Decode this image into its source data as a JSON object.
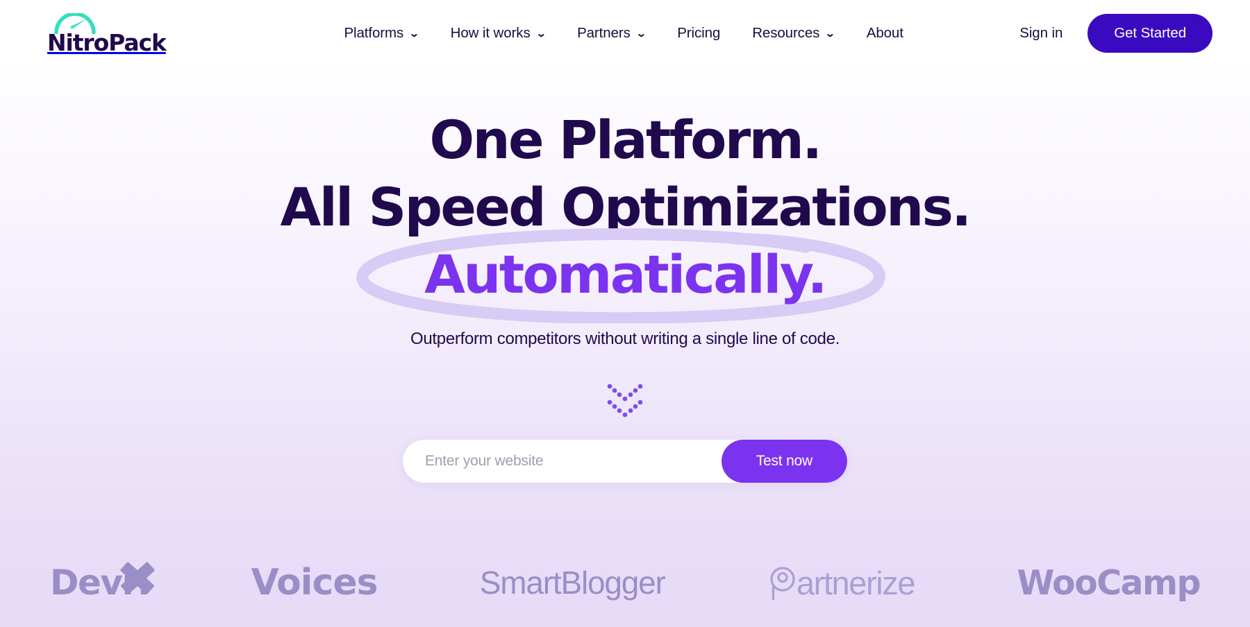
{
  "brand": {
    "name": "NitroPack",
    "logo_icon": "speedometer-icon",
    "accent_teal": "#2fe0bd",
    "wordmark_color": "#21094e"
  },
  "header": {
    "nav": [
      {
        "label": "Platforms",
        "has_dropdown": true
      },
      {
        "label": "How it works",
        "has_dropdown": true
      },
      {
        "label": "Partners",
        "has_dropdown": true
      },
      {
        "label": "Pricing",
        "has_dropdown": false
      },
      {
        "label": "Resources",
        "has_dropdown": true
      },
      {
        "label": "About",
        "has_dropdown": false
      }
    ],
    "caret_glyph": "⌄",
    "sign_in_label": "Sign in",
    "get_started_label": "Get Started",
    "get_started_color": "#3a0ac0"
  },
  "hero": {
    "headline_line1": "One Platform.",
    "headline_line2": "All Speed Optimizations.",
    "headline_accent": "Automatically.",
    "headline_color": "#21094e",
    "accent_color": "#7b33f0",
    "circle_highlight_color": "#d8cbf5",
    "subtitle": "Outperform competitors without writing a single line of code.",
    "scroll_hint_icon": "double-chevron-down-dots-icon",
    "scroll_hint_color": "#7b4cf0"
  },
  "form": {
    "placeholder": "Enter your website",
    "submit_label": "Test now",
    "submit_color": "#7b33f0"
  },
  "clients": {
    "logos": [
      {
        "name": "DevriX",
        "text": "Devri",
        "mark": "x-mark-icon"
      },
      {
        "name": "Voices",
        "text": "Voices",
        "mark": ""
      },
      {
        "name": "SmartBlogger",
        "text": "SmartBlogger",
        "mark": ""
      },
      {
        "name": "Partnerize",
        "text": "artnerize",
        "mark": "circle-p-icon"
      },
      {
        "name": "WooCamp",
        "text": "WooCamp",
        "mark": ""
      }
    ],
    "color": "#9a8ec6"
  }
}
